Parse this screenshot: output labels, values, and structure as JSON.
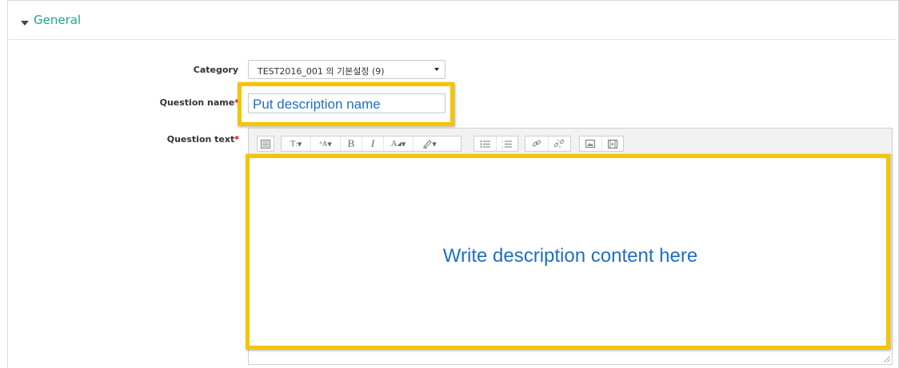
{
  "section": {
    "title": "General"
  },
  "form": {
    "category": {
      "label": "Category",
      "value": "TEST2016_001 의 기본설정 (9)"
    },
    "question_name": {
      "label": "Question name",
      "required_mark": "*",
      "value": "Put description name"
    },
    "question_text": {
      "label": "Question text",
      "required_mark": "*",
      "content": "Write description content here"
    }
  },
  "toolbar": {
    "groups": [
      [
        "toolbar-toggle-icon"
      ],
      [
        "paragraph-style-icon",
        "font-size-icon",
        "bold-icon",
        "italic-icon",
        "font-color-icon",
        "background-color-icon"
      ],
      [
        "unordered-list-icon",
        "ordered-list-icon"
      ],
      [
        "link-icon",
        "unlink-icon"
      ],
      [
        "image-icon",
        "media-icon"
      ]
    ]
  },
  "colors": {
    "accent": "#1fa39a",
    "highlight": "#f5c400",
    "annotation_text": "#1f6ec4",
    "required": "#cc0000"
  }
}
